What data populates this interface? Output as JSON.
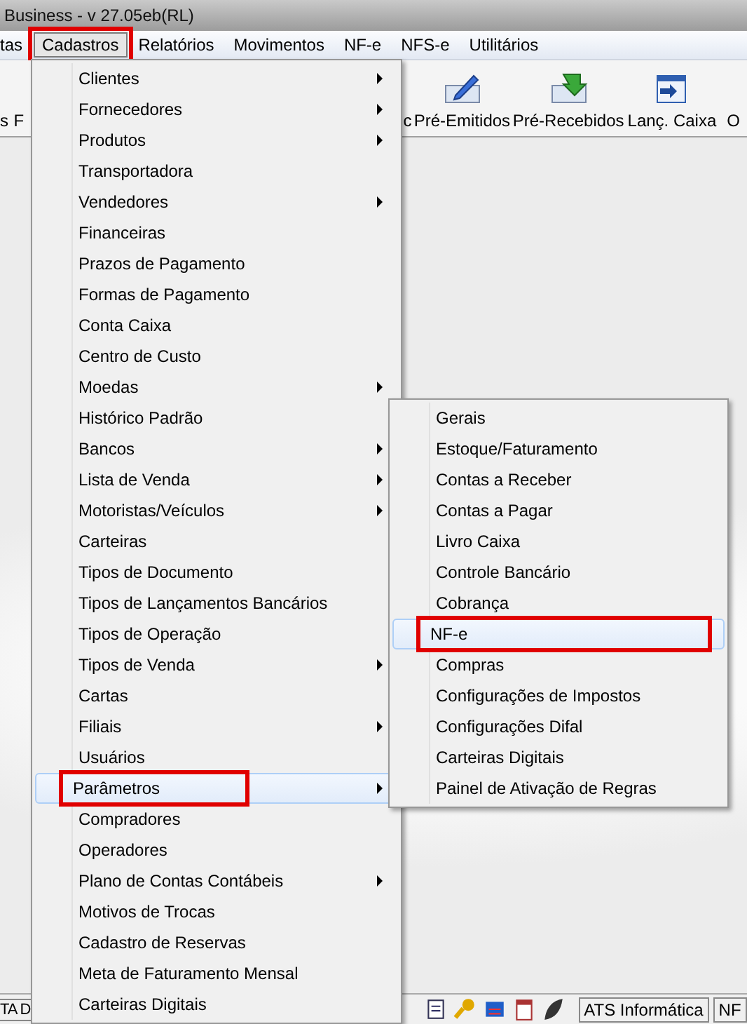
{
  "window": {
    "title": "Business - v 27.05eb(RL)"
  },
  "menubar": [
    {
      "label": "tas",
      "selected": false
    },
    {
      "label": "Cadastros",
      "selected": true
    },
    {
      "label": "Relatórios",
      "selected": false
    },
    {
      "label": "Movimentos",
      "selected": false
    },
    {
      "label": "NF-e",
      "selected": false
    },
    {
      "label": "NFS-e",
      "selected": false
    },
    {
      "label": "Utilitários",
      "selected": false
    }
  ],
  "toolbar": [
    {
      "label": "s",
      "kind": "text"
    },
    {
      "label": "F",
      "kind": "text"
    },
    {
      "label": "c",
      "kind": "text"
    },
    {
      "label": "Pré-Emitidos",
      "kind": "pen"
    },
    {
      "label": "Pré-Recebidos",
      "kind": "receive"
    },
    {
      "label": "Lanç. Caixa",
      "kind": "calendar"
    },
    {
      "label": "O",
      "kind": "text"
    }
  ],
  "cadastros_menu": [
    {
      "label": "Clientes",
      "submenu": true,
      "selected": false
    },
    {
      "label": "Fornecedores",
      "submenu": true,
      "selected": false
    },
    {
      "label": "Produtos",
      "submenu": true,
      "selected": false
    },
    {
      "label": "Transportadora",
      "submenu": false,
      "selected": false
    },
    {
      "label": "Vendedores",
      "submenu": true,
      "selected": false
    },
    {
      "label": "Financeiras",
      "submenu": false,
      "selected": false
    },
    {
      "label": "Prazos de Pagamento",
      "submenu": false,
      "selected": false
    },
    {
      "label": "Formas de Pagamento",
      "submenu": false,
      "selected": false
    },
    {
      "label": "Conta Caixa",
      "submenu": false,
      "selected": false
    },
    {
      "label": "Centro de Custo",
      "submenu": false,
      "selected": false
    },
    {
      "label": "Moedas",
      "submenu": true,
      "selected": false
    },
    {
      "label": "Histórico Padrão",
      "submenu": false,
      "selected": false
    },
    {
      "label": "Bancos",
      "submenu": true,
      "selected": false
    },
    {
      "label": "Lista de Venda",
      "submenu": true,
      "selected": false
    },
    {
      "label": "Motoristas/Veículos",
      "submenu": true,
      "selected": false
    },
    {
      "label": "Carteiras",
      "submenu": false,
      "selected": false
    },
    {
      "label": "Tipos de Documento",
      "submenu": false,
      "selected": false
    },
    {
      "label": "Tipos de Lançamentos Bancários",
      "submenu": false,
      "selected": false
    },
    {
      "label": "Tipos de Operação",
      "submenu": false,
      "selected": false
    },
    {
      "label": "Tipos de Venda",
      "submenu": true,
      "selected": false
    },
    {
      "label": "Cartas",
      "submenu": false,
      "selected": false
    },
    {
      "label": "Filiais",
      "submenu": true,
      "selected": false
    },
    {
      "label": "Usuários",
      "submenu": false,
      "selected": false
    },
    {
      "label": "Parâmetros",
      "submenu": true,
      "selected": true
    },
    {
      "label": "Compradores",
      "submenu": false,
      "selected": false
    },
    {
      "label": "Operadores",
      "submenu": false,
      "selected": false
    },
    {
      "label": "Plano de Contas Contábeis",
      "submenu": true,
      "selected": false
    },
    {
      "label": "Motivos de Trocas",
      "submenu": false,
      "selected": false
    },
    {
      "label": "Cadastro de Reservas",
      "submenu": false,
      "selected": false
    },
    {
      "label": "Meta de Faturamento Mensal",
      "submenu": false,
      "selected": false
    },
    {
      "label": "Carteiras Digitais",
      "submenu": false,
      "selected": false
    }
  ],
  "parametros_menu": [
    {
      "label": "Gerais",
      "selected": false
    },
    {
      "label": "Estoque/Faturamento",
      "selected": false
    },
    {
      "label": "Contas a Receber",
      "selected": false
    },
    {
      "label": "Contas a Pagar",
      "selected": false
    },
    {
      "label": "Livro Caixa",
      "selected": false
    },
    {
      "label": "Controle Bancário",
      "selected": false
    },
    {
      "label": "Cobrança",
      "selected": false
    },
    {
      "label": "NF-e",
      "selected": true
    },
    {
      "label": "Compras",
      "selected": false
    },
    {
      "label": "Configurações de Impostos",
      "selected": false
    },
    {
      "label": "Configurações Difal",
      "selected": false
    },
    {
      "label": "Carteiras Digitais",
      "selected": false
    },
    {
      "label": "Painel de Ativação de Regras",
      "selected": false
    }
  ],
  "status_bar": {
    "left": "TA D",
    "company": "ATS Informática",
    "right": "NF"
  }
}
